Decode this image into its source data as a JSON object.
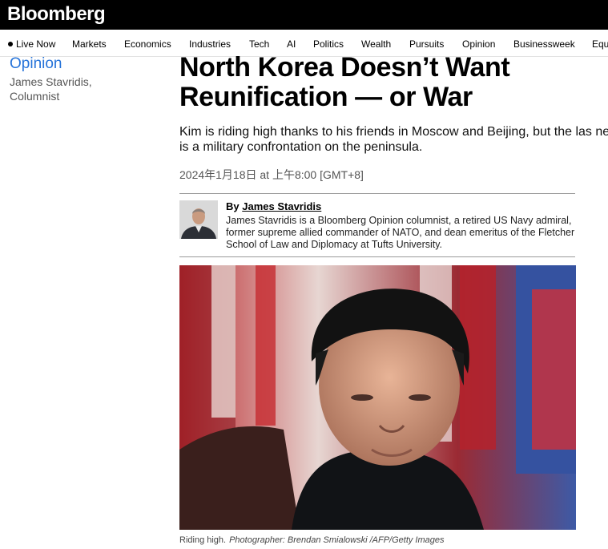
{
  "header": {
    "logo": "Bloomberg"
  },
  "nav": {
    "live": "Live Now",
    "items": [
      "Markets",
      "Economics",
      "Industries",
      "Tech",
      "AI",
      "Politics",
      "Wealth",
      "Pursuits",
      "Opinion",
      "Businessweek",
      "Equ"
    ]
  },
  "sidebar": {
    "section": "Opinion",
    "author_line1": "James Stavridis,",
    "author_line2": "Columnist"
  },
  "article": {
    "headline": "North Korea Doesn’t Want Reunification — or War",
    "dek": "Kim is riding high thanks to his friends in Moscow and Beijing, but the las need is a military confrontation on the peninsula.",
    "date": "2024年1月18日 at 上午8:00 [GMT+8]",
    "byline_prefix": "By",
    "author": "James Stavridis",
    "bio": "James Stavridis is a Bloomberg Opinion columnist, a retired US Navy admiral, former supreme allied commander of NATO, and dean emeritus of the Fletcher School of Law and Diplomacy at Tufts University.",
    "caption": "Riding high.",
    "credit": "Photographer: Brendan Smialowski /AFP/Getty Images"
  }
}
